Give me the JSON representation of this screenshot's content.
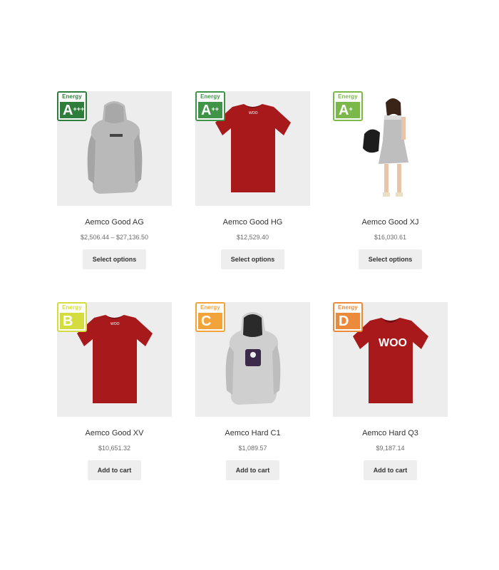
{
  "products": [
    {
      "name": "Aemco Good AG",
      "price": "$2,506.44 – $27,136.50",
      "button": "Select options",
      "energy_label": "Energy",
      "energy_class": "A",
      "energy_sup": "+++",
      "energy_color": "#2f7d3a",
      "image": "grey-hoodie-back"
    },
    {
      "name": "Aemco Good HG",
      "price": "$12,529.40",
      "button": "Select options",
      "energy_label": "Energy",
      "energy_class": "A",
      "energy_sup": "++",
      "energy_color": "#3f9447",
      "image": "red-tshirt-back"
    },
    {
      "name": "Aemco Good XJ",
      "price": "$16,030.61",
      "button": "Select options",
      "energy_label": "Energy",
      "energy_class": "A",
      "energy_sup": "+",
      "energy_color": "#7bb84a",
      "image": "woman-dress"
    },
    {
      "name": "Aemco Good XV",
      "price": "$10,651.32",
      "button": "Add to cart",
      "energy_label": "Energy",
      "energy_class": "B",
      "energy_sup": "",
      "energy_color": "#d4dd3d",
      "image": "red-tshirt-back"
    },
    {
      "name": "Aemco Hard C1",
      "price": "$1,089.57",
      "button": "Add to cart",
      "energy_label": "Energy",
      "energy_class": "C",
      "energy_sup": "",
      "energy_color": "#f2a33a",
      "image": "grey-hoodie-front"
    },
    {
      "name": "Aemco Hard Q3",
      "price": "$9,187.14",
      "button": "Add to cart",
      "energy_label": "Energy",
      "energy_class": "D",
      "energy_sup": "",
      "energy_color": "#ec8a3c",
      "image": "red-tshirt-woo"
    }
  ]
}
